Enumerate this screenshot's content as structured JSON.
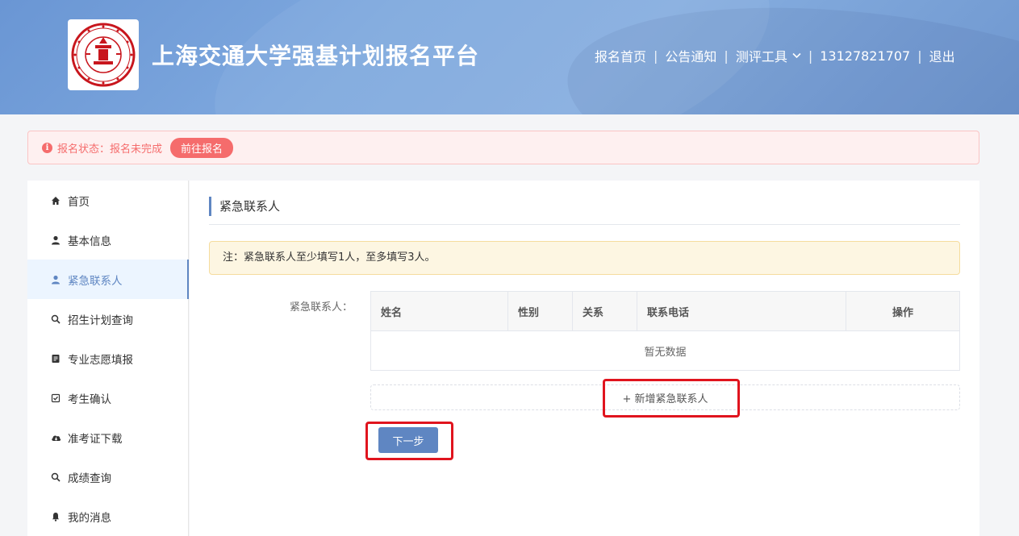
{
  "header": {
    "title": "上海交通大学强基计划报名平台",
    "logo_icon": "sjtu-seal-logo",
    "nav": [
      {
        "label": "报名首页"
      },
      {
        "label": "公告通知"
      },
      {
        "label": "测评工具",
        "has_dropdown": true
      },
      {
        "label": "13127821707"
      },
      {
        "label": "退出"
      }
    ],
    "nav_separator": "|"
  },
  "alert": {
    "icon": "info-icon",
    "icon_glyph": "i",
    "status_text": "报名状态：报名未完成",
    "action_label": "前往报名",
    "color": "#f56c6c"
  },
  "sidebar": {
    "items": [
      {
        "label": "首页",
        "icon": "home-icon"
      },
      {
        "label": "基本信息",
        "icon": "user-icon"
      },
      {
        "label": "紧急联系人",
        "icon": "user-icon",
        "active": true
      },
      {
        "label": "招生计划查询",
        "icon": "search-icon"
      },
      {
        "label": "专业志愿填报",
        "icon": "document-icon"
      },
      {
        "label": "考生确认",
        "icon": "check-square-icon"
      },
      {
        "label": "准考证下载",
        "icon": "cloud-download-icon"
      },
      {
        "label": "成绩查询",
        "icon": "search-icon"
      },
      {
        "label": "我的消息",
        "icon": "bell-icon"
      }
    ]
  },
  "main": {
    "section_title": "紧急联系人",
    "note": "注：紧急联系人至少填写1人，至多填写3人。",
    "field_label": "紧急联系人：",
    "table": {
      "columns": [
        "姓名",
        "性别",
        "关系",
        "联系电话",
        "操作"
      ],
      "empty_text": "暂无数据"
    },
    "add_label": "+ 新增紧急联系人",
    "next_label": "下一步"
  },
  "colors": {
    "accent": "#5f86c2",
    "highlight": "#e0141e",
    "seal": "#c8161d"
  }
}
